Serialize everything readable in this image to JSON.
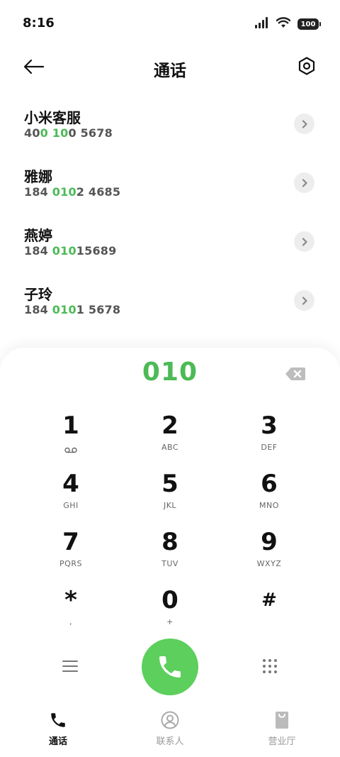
{
  "status_bar": {
    "time": "8:16",
    "battery": "100",
    "icons": [
      "signal-icon",
      "wifi-icon",
      "battery-icon"
    ]
  },
  "header": {
    "title": "通话",
    "back_icon": "back-arrow-icon",
    "settings_icon": "settings-hexagon-icon"
  },
  "results": [
    {
      "name": "小米客服",
      "number_parts": [
        [
          "40",
          false
        ],
        [
          "0",
          true
        ],
        [
          " ",
          false
        ],
        [
          "10",
          true
        ],
        [
          "0 5678",
          false
        ]
      ]
    },
    {
      "name": "雅娜",
      "number_parts": [
        [
          "184 ",
          false
        ],
        [
          "010",
          true
        ],
        [
          "2 4685",
          false
        ]
      ]
    },
    {
      "name": "燕婷",
      "number_parts": [
        [
          "184 ",
          false
        ],
        [
          "010",
          true
        ],
        [
          "15689",
          false
        ]
      ]
    },
    {
      "name": "子玲",
      "number_parts": [
        [
          "184 ",
          false
        ],
        [
          "010",
          true
        ],
        [
          "1 5678",
          false
        ]
      ]
    }
  ],
  "dialpad": {
    "input": "010",
    "keys": [
      {
        "digit": "1",
        "letters": ""
      },
      {
        "digit": "2",
        "letters": "ABC"
      },
      {
        "digit": "3",
        "letters": "DEF"
      },
      {
        "digit": "4",
        "letters": "GHI"
      },
      {
        "digit": "5",
        "letters": "JKL"
      },
      {
        "digit": "6",
        "letters": "MNO"
      },
      {
        "digit": "7",
        "letters": "PQRS"
      },
      {
        "digit": "8",
        "letters": "TUV"
      },
      {
        "digit": "9",
        "letters": "WXYZ"
      },
      {
        "digit": "*",
        "letters": ","
      },
      {
        "digit": "0",
        "letters": "+"
      },
      {
        "digit": "#",
        "letters": ""
      }
    ]
  },
  "bottom_nav": [
    {
      "label": "通话",
      "active": true,
      "icon": "phone-icon"
    },
    {
      "label": "联系人",
      "active": false,
      "icon": "contacts-icon"
    },
    {
      "label": "营业厅",
      "active": false,
      "icon": "shopping-bag-icon"
    }
  ],
  "colors": {
    "accent": "#4cba56",
    "call_button": "#5ccf5c"
  }
}
